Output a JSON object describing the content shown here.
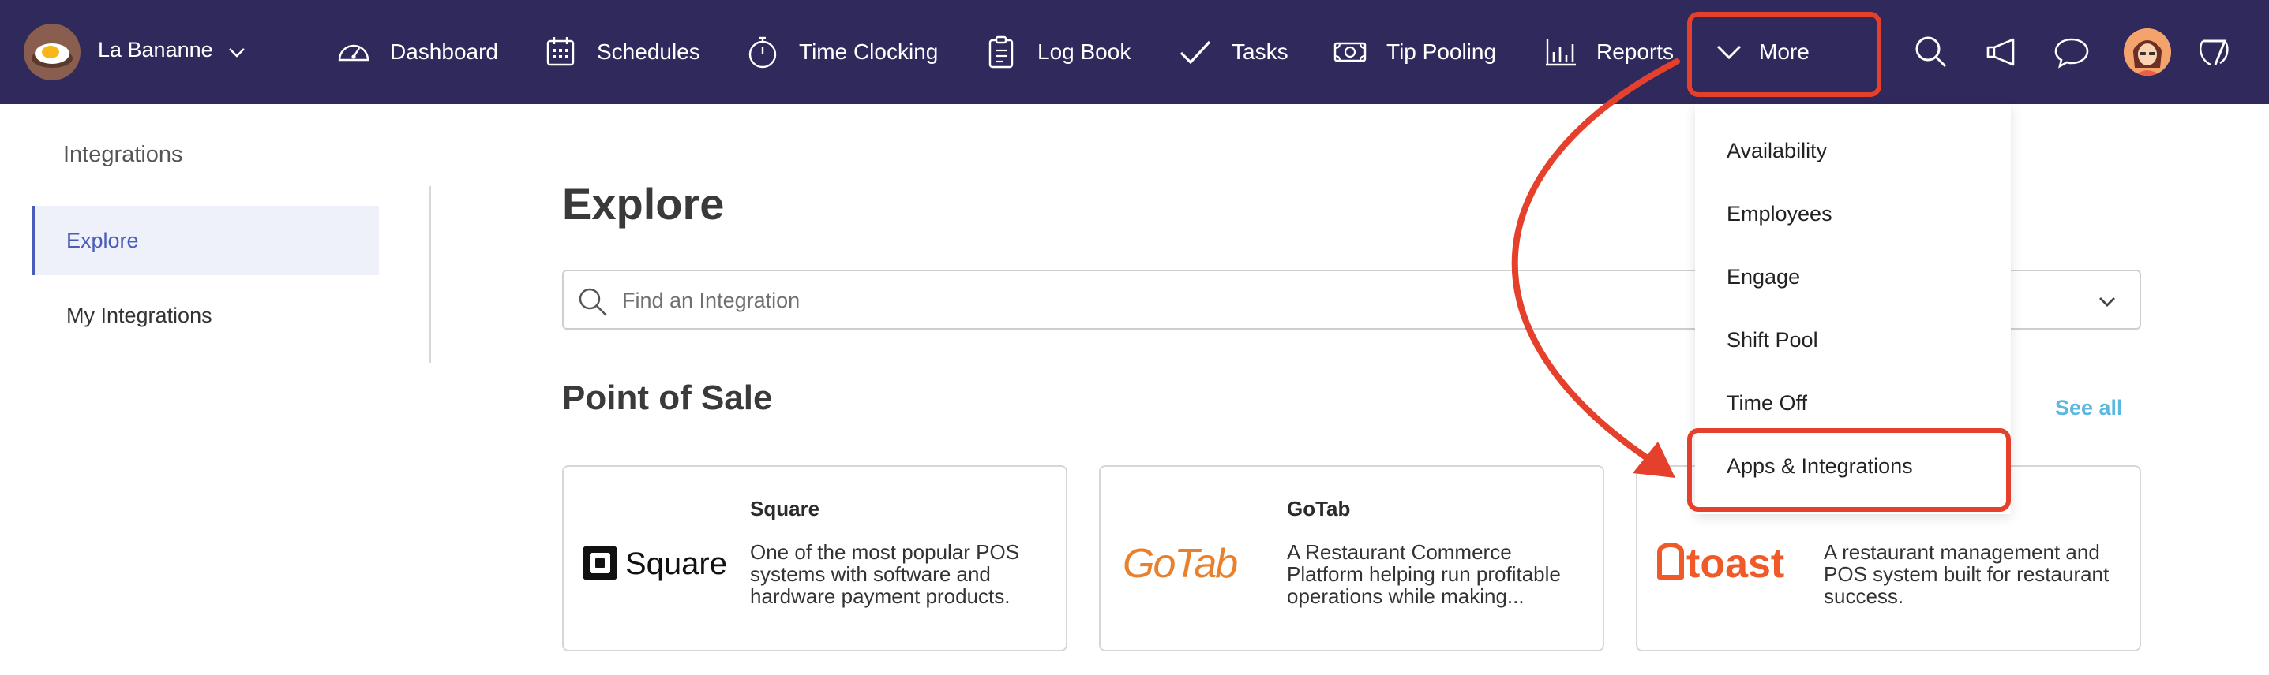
{
  "brand": {
    "name": "La Bananne"
  },
  "nav": {
    "items": [
      {
        "label": "Dashboard",
        "icon": "dashboard-icon"
      },
      {
        "label": "Schedules",
        "icon": "calendar-icon"
      },
      {
        "label": "Time Clocking",
        "icon": "stopwatch-icon"
      },
      {
        "label": "Log Book",
        "icon": "clipboard-icon"
      },
      {
        "label": "Tasks",
        "icon": "checkmark-icon"
      },
      {
        "label": "Tip Pooling",
        "icon": "money-icon"
      },
      {
        "label": "Reports",
        "icon": "bar-chart-icon"
      },
      {
        "label": "More",
        "icon": "chevron-down-icon"
      }
    ],
    "right_icons": [
      "search-icon",
      "megaphone-icon",
      "chat-icon",
      "user-avatar",
      "7shifts-logo-icon"
    ]
  },
  "sidebar": {
    "title": "Integrations",
    "items": [
      {
        "label": "Explore",
        "active": true
      },
      {
        "label": "My Integrations",
        "active": false
      }
    ]
  },
  "main": {
    "title": "Explore",
    "search": {
      "placeholder": "Find an Integration",
      "value": ""
    },
    "section": {
      "title": "Point of Sale",
      "see_all": "See all"
    },
    "cards": [
      {
        "name": "Square",
        "logo_text": "Square",
        "description": "One of the most popular POS systems with software and hardware payment products."
      },
      {
        "name": "GoTab",
        "logo_text": "GoTab",
        "description": "A Restaurant Commerce Platform helping run profitable operations while making..."
      },
      {
        "name": "",
        "logo_text": "toast",
        "description": "A restaurant management and POS system built for restaurant success."
      }
    ]
  },
  "dropdown": {
    "items": [
      "Availability",
      "Employees",
      "Engage",
      "Shift Pool",
      "Time Off",
      "Apps & Integrations"
    ]
  },
  "colors": {
    "topbar": "#30295c",
    "accent": "#4a5bb8",
    "annotation": "#e5402b",
    "link": "#5cb8e0",
    "gotab": "#e8802c",
    "toast": "#f05a28"
  }
}
